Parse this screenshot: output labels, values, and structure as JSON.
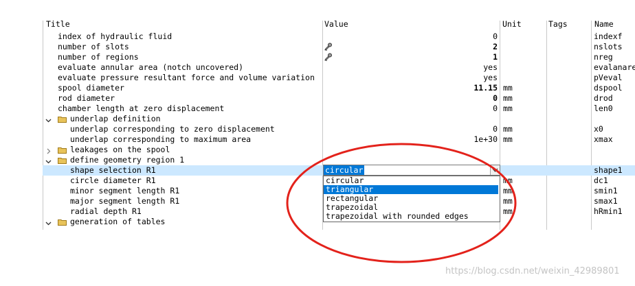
{
  "headers": {
    "title": "Title",
    "value": "Value",
    "unit": "Unit",
    "tags": "Tags",
    "name": "Name"
  },
  "rows": [
    {
      "title": "index of hydraulic fluid",
      "value": "0",
      "unit": "",
      "name": "indexf"
    },
    {
      "title": "number of slots",
      "value": "2",
      "unit": "",
      "name": "nslots"
    },
    {
      "title": "number of regions",
      "value": "1",
      "unit": "",
      "name": "nreg"
    },
    {
      "title": "evaluate annular area (notch uncovered)",
      "value": "yes",
      "unit": "",
      "name": "evalanare"
    },
    {
      "title": "evaluate pressure resultant force and volume variation",
      "value": "yes",
      "unit": "",
      "name": "pVeval"
    },
    {
      "title": "spool diameter",
      "value": "11.15",
      "unit": "mm",
      "name": "dspool"
    },
    {
      "title": "rod diameter",
      "value": "0",
      "unit": "mm",
      "name": "drod"
    },
    {
      "title": "chamber length at zero displacement",
      "value": "0",
      "unit": "mm",
      "name": "len0"
    },
    {
      "title": "underlap definition",
      "value": "",
      "unit": "",
      "name": ""
    },
    {
      "title": "underlap corresponding to zero displacement",
      "value": "0",
      "unit": "mm",
      "name": "x0"
    },
    {
      "title": "underlap corresponding to maximum area",
      "value": "1e+30",
      "unit": "mm",
      "name": "xmax"
    },
    {
      "title": "leakages on the spool",
      "value": "",
      "unit": "",
      "name": ""
    },
    {
      "title": "define geometry region 1",
      "value": "",
      "unit": "",
      "name": ""
    },
    {
      "title": "shape selection R1",
      "value": "",
      "unit": "",
      "name": "shape1"
    },
    {
      "title": "circle diameter R1",
      "value": "",
      "unit": "mm",
      "name": "dc1"
    },
    {
      "title": "minor segment length R1",
      "value": "",
      "unit": "mm",
      "name": "smin1"
    },
    {
      "title": "major segment length R1",
      "value": "",
      "unit": "mm",
      "name": "smax1"
    },
    {
      "title": "radial depth R1",
      "value": "",
      "unit": "mm",
      "name": "hRmin1"
    },
    {
      "title": "generation of tables",
      "value": "",
      "unit": "",
      "name": ""
    }
  ],
  "combo": {
    "selected": "circular"
  },
  "dropdown": {
    "options": [
      "circular",
      "triangular",
      "rectangular",
      "trapezoidal",
      "trapezoidal with rounded edges"
    ],
    "highlighted_index": 1
  },
  "watermark": "https://blog.csdn.net/weixin_42989801",
  "colors": {
    "selection": "#cce8ff",
    "highlight": "#0078d7",
    "annotation": "#e3221b",
    "folder": "#e8c35a"
  }
}
